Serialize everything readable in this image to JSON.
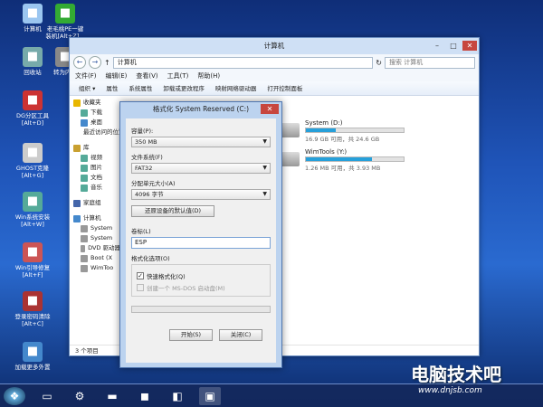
{
  "desktop_icons": [
    {
      "label": "计算机",
      "icon": "computer-icon",
      "color": "#9bc6f0"
    },
    {
      "label": "回收站",
      "icon": "recycle-bin-icon",
      "color": "#7aa"
    },
    {
      "label": "DG分区工具\n[Alt+D]",
      "icon": "partition-tool-icon",
      "color": "#c33"
    },
    {
      "label": "GHOST克隆\n[Alt+G]",
      "icon": "ghost-icon",
      "color": "#ccc"
    },
    {
      "label": "Win系统安装\n[Alt+W]",
      "icon": "win-install-icon",
      "color": "#5a9"
    },
    {
      "label": "Win引导修复\n[Alt+F]",
      "icon": "boot-repair-icon",
      "color": "#c55"
    },
    {
      "label": "登录密码清除\n[Alt+C]",
      "icon": "password-clear-icon",
      "color": "#a33"
    },
    {
      "label": "加载更多外置",
      "icon": "load-more-icon",
      "color": "#48c"
    },
    {
      "label": "老毛桃PE一键\n装机[Alt+Z]...",
      "icon": "pe-installer-icon",
      "color": "#3a3"
    },
    {
      "label": "转为内置",
      "icon": "convert-icon",
      "color": "#888"
    }
  ],
  "explorer": {
    "title": "计算机",
    "address": "计算机",
    "search_placeholder": "搜索 计算机",
    "menu": [
      "文件(F)",
      "编辑(E)",
      "查看(V)",
      "工具(T)",
      "帮助(H)"
    ],
    "toolbar": [
      "组织 ▾",
      "属性",
      "系统属性",
      "卸载或更改程序",
      "映射网络驱动器",
      "打开控制面板"
    ],
    "nav": [
      "收藏夹",
      "下载",
      "桌面",
      "最近访问的位置",
      "库",
      "视频",
      "图片",
      "文档",
      "音乐",
      "家庭组",
      "计算机",
      "System",
      "System",
      "DVD 驱动器",
      "Boot (X",
      "WimToo"
    ],
    "drives": [
      {
        "name": "System (D:)",
        "free": "16.9 GB 可用，共 24.6 GB",
        "used": 0.31
      },
      {
        "name": "WimTools (Y:)",
        "free": "1.26 MB 可用，共 3.93 MB",
        "used": 0.68
      }
    ],
    "status": "3 个项目"
  },
  "dialog": {
    "title": "格式化 System Reserved (C:)",
    "capacity_label": "容量(P):",
    "capacity": "350 MB",
    "fs_label": "文件系统(F)",
    "fs": "FAT32",
    "alloc_label": "分配单元大小(A)",
    "alloc": "4096 字节",
    "restore_btn": "还原设备的默认值(D)",
    "volume_label": "卷标(L)",
    "volume": "ESP",
    "options_label": "格式化选项(O)",
    "quick": "快速格式化(Q)",
    "msdos": "创建一个 MS-DOS 启动盘(M)",
    "start_btn": "开始(S)",
    "close_btn": "关闭(C)"
  },
  "brand": {
    "name": "电脑技术吧",
    "url": "www.dnjsb.com"
  }
}
